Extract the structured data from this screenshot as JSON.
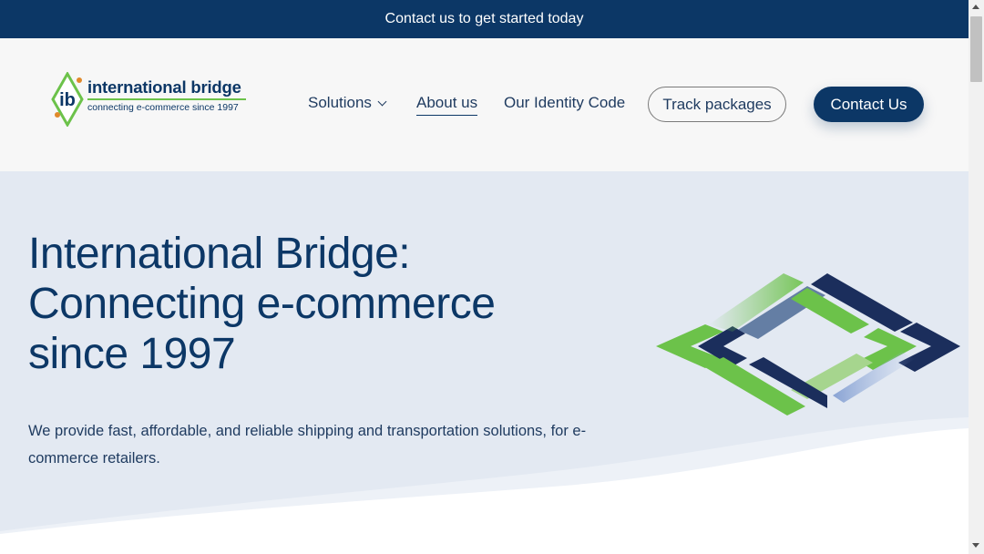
{
  "announcement": {
    "text": "Contact us to get started today"
  },
  "logo": {
    "monogram": "ib",
    "name": "international bridge",
    "tagline": "connecting e-commerce since 1997"
  },
  "nav": {
    "solutions": "Solutions",
    "about": "About us",
    "identity": "Our Identity Code",
    "track": "Track packages",
    "contact": "Contact Us"
  },
  "hero": {
    "title_line1": "International Bridge:",
    "title_line2": "Connecting e-commerce",
    "title_line3": "since 1997",
    "description": "We provide fast, affordable, and reliable shipping and transportation solutions, for e-commerce retailers."
  },
  "colors": {
    "brand_navy": "#0c3766",
    "brand_green": "#6cc24a",
    "hero_background": "#e3e9f2",
    "header_background": "#f7f7f7"
  }
}
